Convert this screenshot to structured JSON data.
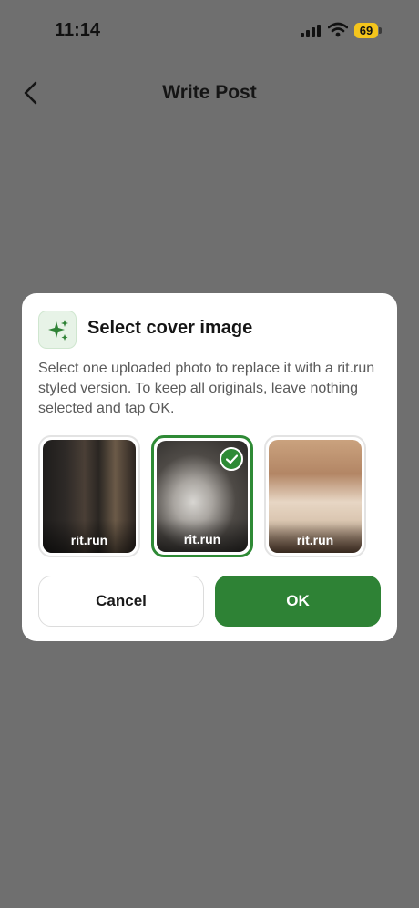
{
  "status_bar": {
    "time": "11:14",
    "battery": "69"
  },
  "nav": {
    "title": "Write Post"
  },
  "dialog": {
    "title": "Select cover image",
    "description": "Select one uploaded photo to replace it with a rit.run styled version. To keep all originals, leave nothing selected and tap OK.",
    "photos": [
      {
        "watermark": "rit.run",
        "selected": false
      },
      {
        "watermark": "rit.run",
        "selected": true
      },
      {
        "watermark": "rit.run",
        "selected": false
      }
    ],
    "cancel_label": "Cancel",
    "ok_label": "OK"
  },
  "colors": {
    "accent": "#2e8235",
    "overlay": "#6f6f6f",
    "badge": "#f4c51c"
  },
  "icons": [
    "back-chevron-icon",
    "sparkles-icon",
    "checkmark-icon",
    "signal-icon",
    "wifi-icon",
    "battery-icon"
  ]
}
